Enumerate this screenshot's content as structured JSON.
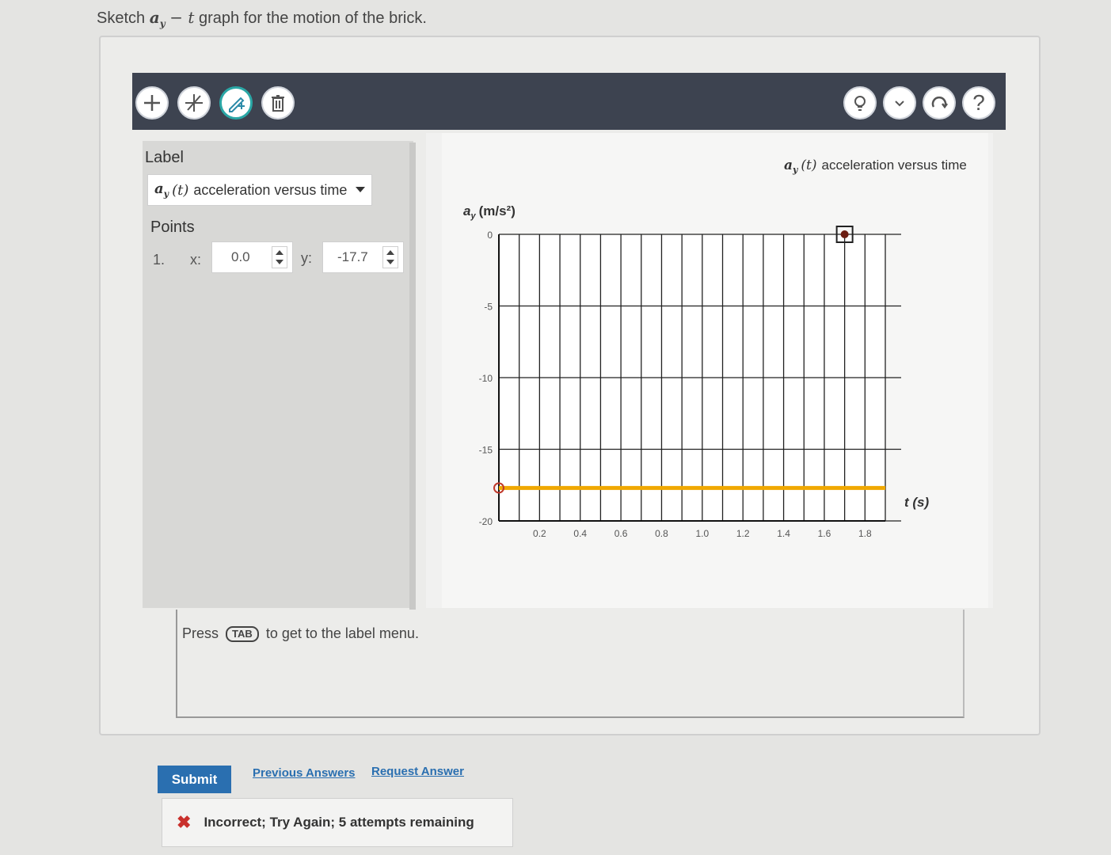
{
  "prompt": {
    "prefix": "Sketch",
    "var": "a",
    "var_sub": "y",
    "dash_t": "− t",
    "suffix": "graph for the motion of the brick."
  },
  "toolbar": {
    "left_tools": [
      "plus-icon",
      "no-vector-icon",
      "draw-icon",
      "trash-icon"
    ],
    "right_tools": [
      "lightbulb-icon",
      "chevron-down-icon",
      "reset-icon",
      "help-icon"
    ],
    "help_label": "?"
  },
  "sidebar": {
    "label_title": "Label",
    "select_var": "a",
    "select_sub": "y",
    "select_arg": "(t)",
    "select_text": "acceleration versus time",
    "points_title": "Points",
    "point_index": "1.",
    "x_label": "x:",
    "x_value": "0.0",
    "y_label": "y:",
    "y_value": "-17.7"
  },
  "graph": {
    "title_var": "a",
    "title_sub": "y",
    "title_arg": "(t)",
    "title_text": "acceleration versus time",
    "ylabel_var": "a",
    "ylabel_sub": "y",
    "ylabel_unit": "(m/s²)",
    "xlabel": "t (s)",
    "accent_color": "#f0a800"
  },
  "chart_data": {
    "type": "line",
    "title": "a_y (t) acceleration versus time",
    "xlabel": "t (s)",
    "ylabel": "a_y (m/s²)",
    "xlim": [
      0,
      1.9
    ],
    "ylim": [
      -20,
      0
    ],
    "x_ticks": [
      "0.2",
      "0.4",
      "0.6",
      "0.8",
      "1.0",
      "1.2",
      "1.4",
      "1.6",
      "1.8"
    ],
    "y_ticks": [
      "0",
      "-5",
      "-10",
      "-15",
      "-20"
    ],
    "grid": true,
    "series": [
      {
        "x": [
          0.0,
          1.9
        ],
        "y": [
          -17.7,
          -17.7
        ]
      }
    ],
    "points": [
      {
        "x": 0.0,
        "y": -17.7
      }
    ],
    "marker_point": {
      "x": 1.7,
      "y": 0
    }
  },
  "footer": {
    "tab_hint_before": "Press",
    "tab_key": "TAB",
    "tab_hint_after": "to get to the label menu.",
    "submit_label": "Submit",
    "previous_answers": "Previous Answers",
    "request_answer": "Request Answer",
    "feedback_mark": "✖",
    "feedback_text": "Incorrect; Try Again; 5 attempts remaining"
  }
}
